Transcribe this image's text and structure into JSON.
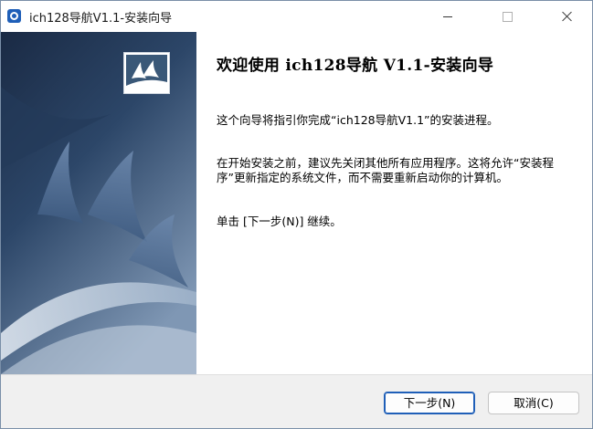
{
  "window": {
    "title": "ich128导航V1.1-安装向导",
    "icons": {
      "app": "app-q-icon",
      "minimize": "minimize-icon",
      "maximize": "maximize-icon",
      "close": "close-icon"
    }
  },
  "banner": {
    "logo_icon": "installer-logo-icon",
    "colors": {
      "dark": "#1d2f4a",
      "mid": "#3c5a82",
      "light": "#cdd8e6"
    }
  },
  "content": {
    "heading": "欢迎使用 ich128导航 V1.1-安装向导",
    "paragraph1": "这个向导将指引你完成“ich128导航V1.1”的安装进程。",
    "paragraph2": "在开始安装之前，建议先关闭其他所有应用程序。这将允许“安装程序”更新指定的系统文件，而不需要重新启动你的计算机。",
    "paragraph3": "单击 [下一步(N)] 继续。"
  },
  "buttons": {
    "next": "下一步(N)",
    "cancel": "取消(C)"
  },
  "colors": {
    "accent": "#1f5fb8",
    "bottom_bar": "#f0f0f0"
  }
}
